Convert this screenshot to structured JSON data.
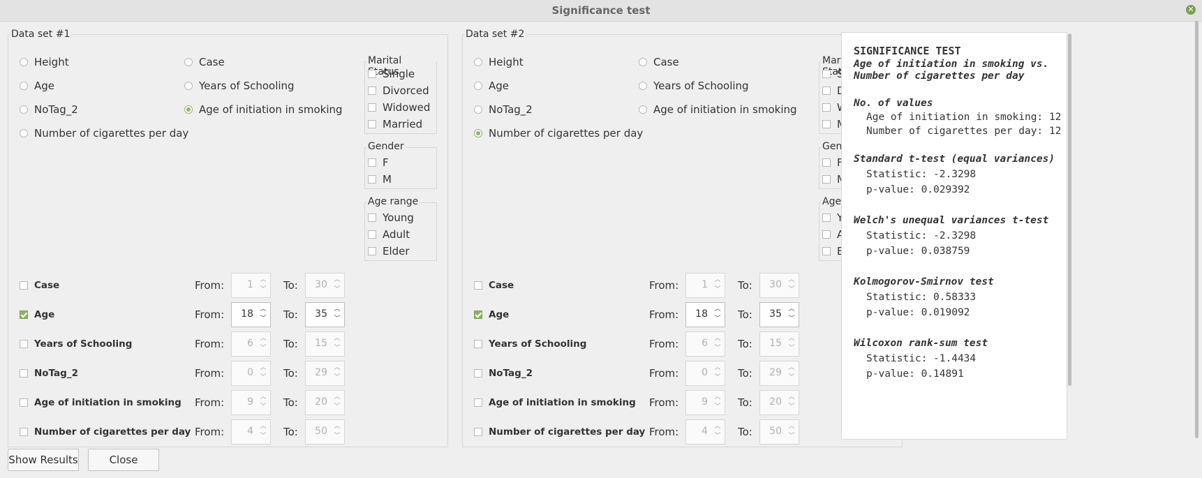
{
  "window": {
    "title": "Significance test"
  },
  "sets": [
    {
      "label": "Data set #1",
      "variables": [
        "Height",
        "Case",
        "Age",
        "Years of Schooling",
        "NoTag_2",
        "Age of initiation in smoking",
        "Number of cigarettes per day"
      ],
      "selected_variable": "Age of initiation in smoking",
      "marital": {
        "label": "Marital Status",
        "items": [
          "Single",
          "Divorced",
          "Widowed",
          "Married"
        ]
      },
      "gender": {
        "label": "Gender",
        "items": [
          "F",
          "M"
        ]
      },
      "age_range": {
        "label": "Age range",
        "items": [
          "Young",
          "Adult",
          "Elder"
        ]
      },
      "filters": [
        {
          "name": "Case",
          "checked": false,
          "from": "1",
          "to": "30"
        },
        {
          "name": "Age",
          "checked": true,
          "from": "18",
          "to": "35"
        },
        {
          "name": "Years of Schooling",
          "checked": false,
          "from": "6",
          "to": "15"
        },
        {
          "name": "NoTag_2",
          "checked": false,
          "from": "0",
          "to": "29"
        },
        {
          "name": "Age of initiation in smoking",
          "checked": false,
          "from": "9",
          "to": "20"
        },
        {
          "name": "Number of cigarettes per day",
          "checked": false,
          "from": "4",
          "to": "50"
        }
      ]
    },
    {
      "label": "Data set #2",
      "variables": [
        "Height",
        "Case",
        "Age",
        "Years of Schooling",
        "NoTag_2",
        "Age of initiation in smoking",
        "Number of cigarettes per day"
      ],
      "selected_variable": "Number of cigarettes per day",
      "marital": {
        "label": "Marital Status",
        "items": [
          "Single",
          "Divorced",
          "Widowed",
          "Married"
        ]
      },
      "gender": {
        "label": "Gender",
        "items": [
          "F",
          "M"
        ]
      },
      "age_range": {
        "label": "Age range",
        "items": [
          "Young",
          "Adult",
          "Elder"
        ]
      },
      "filters": [
        {
          "name": "Case",
          "checked": false,
          "from": "1",
          "to": "30"
        },
        {
          "name": "Age",
          "checked": true,
          "from": "18",
          "to": "35"
        },
        {
          "name": "Years of Schooling",
          "checked": false,
          "from": "6",
          "to": "15"
        },
        {
          "name": "NoTag_2",
          "checked": false,
          "from": "0",
          "to": "29"
        },
        {
          "name": "Age of initiation in smoking",
          "checked": false,
          "from": "9",
          "to": "20"
        },
        {
          "name": "Number of cigarettes per day",
          "checked": false,
          "from": "4",
          "to": "50"
        }
      ]
    }
  ],
  "from_label": "From:",
  "to_label": "To:",
  "results": {
    "title": "SIGNIFICANCE TEST",
    "subtitle1": "Age of initiation in smoking vs.",
    "subtitle2": "Number of cigarettes per day",
    "count_header": "No. of values",
    "count1": "Age of initiation in smoking: 12",
    "count2": "Number of cigarettes per day: 12",
    "tests": [
      {
        "name": "Standard t-test (equal variances)",
        "statistic": "Statistic: -2.3298",
        "pvalue": "p-value: 0.029392"
      },
      {
        "name": "Welch's unequal variances t-test",
        "statistic": "Statistic: -2.3298",
        "pvalue": "p-value: 0.038759"
      },
      {
        "name": "Kolmogorov-Smirnov test",
        "statistic": "Statistic: 0.58333",
        "pvalue": "p-value: 0.019092"
      },
      {
        "name": "Wilcoxon rank-sum test",
        "statistic": "Statistic: -1.4434",
        "pvalue": "p-value: 0.14891"
      }
    ]
  },
  "buttons": {
    "show_results": "Show Results",
    "close": "Close"
  },
  "colors": {
    "accent": "#8cb36a",
    "background": "#efefef"
  }
}
